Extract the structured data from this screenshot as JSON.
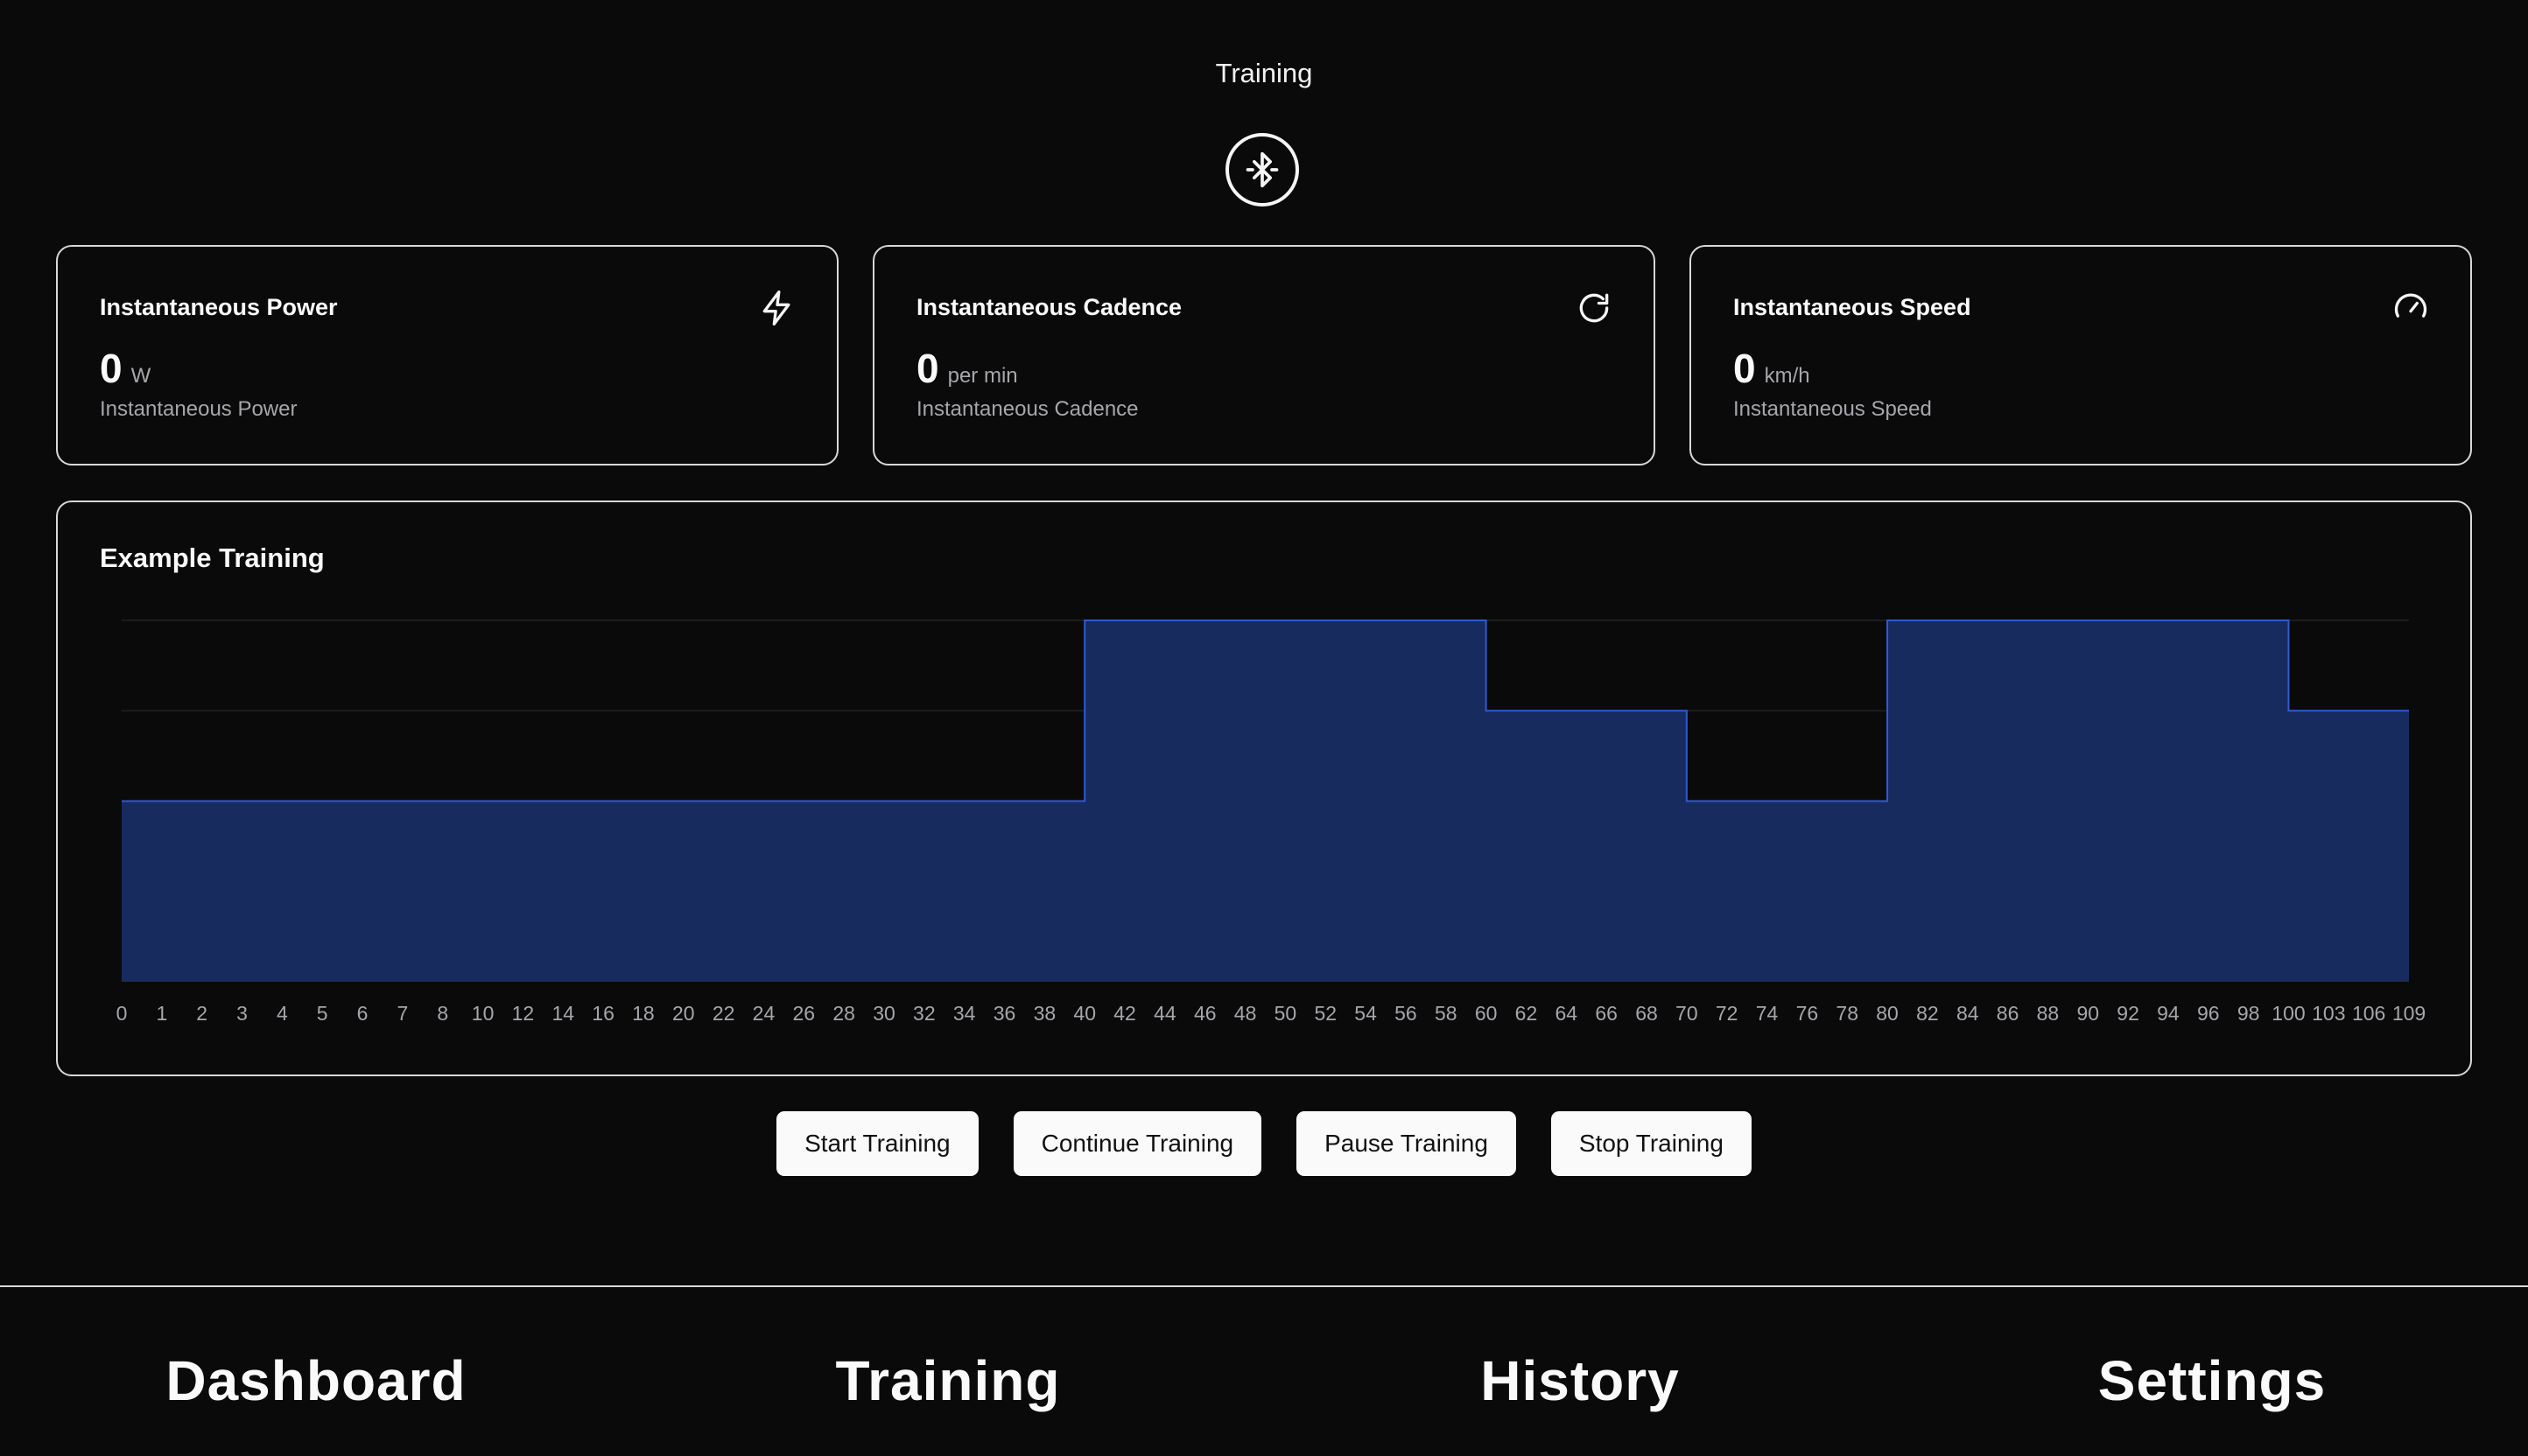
{
  "header": {
    "title": "Training",
    "bluetooth_icon": "bluetooth-icon"
  },
  "stats": [
    {
      "title": "Instantaneous Power",
      "value": "0",
      "unit": "W",
      "subtitle": "Instantaneous Power",
      "icon": "lightning-icon"
    },
    {
      "title": "Instantaneous Cadence",
      "value": "0",
      "unit": "per min",
      "subtitle": "Instantaneous Cadence",
      "icon": "refresh-icon"
    },
    {
      "title": "Instantaneous Speed",
      "value": "0",
      "unit": "km/h",
      "subtitle": "Instantaneous Speed",
      "icon": "gauge-icon"
    }
  ],
  "chart": {
    "title": "Example Training",
    "fill_color": "#182b5f",
    "stroke_color": "#2f5bd1"
  },
  "chart_data": {
    "type": "area",
    "title": "Example Training",
    "step": true,
    "x_ticks": [
      0,
      1,
      2,
      3,
      4,
      5,
      6,
      7,
      8,
      10,
      12,
      14,
      16,
      18,
      20,
      22,
      24,
      26,
      28,
      30,
      32,
      34,
      36,
      38,
      40,
      42,
      44,
      46,
      48,
      50,
      52,
      54,
      56,
      58,
      60,
      62,
      64,
      66,
      68,
      70,
      72,
      74,
      76,
      78,
      80,
      82,
      84,
      86,
      88,
      90,
      92,
      94,
      96,
      98,
      100,
      103,
      106,
      109
    ],
    "segments": [
      {
        "start": 0,
        "end": 40,
        "level": 2
      },
      {
        "start": 40,
        "end": 60,
        "level": 4
      },
      {
        "start": 60,
        "end": 70,
        "level": 3
      },
      {
        "start": 70,
        "end": 80,
        "level": 2
      },
      {
        "start": 80,
        "end": 100,
        "level": 4
      },
      {
        "start": 100,
        "end": 109,
        "level": 3
      }
    ],
    "ylim": [
      0,
      4
    ],
    "grid": true
  },
  "actions": {
    "start": "Start Training",
    "continue": "Continue Training",
    "pause": "Pause Training",
    "stop": "Stop Training"
  },
  "nav": {
    "dashboard": "Dashboard",
    "training": "Training",
    "history": "History",
    "settings": "Settings"
  }
}
